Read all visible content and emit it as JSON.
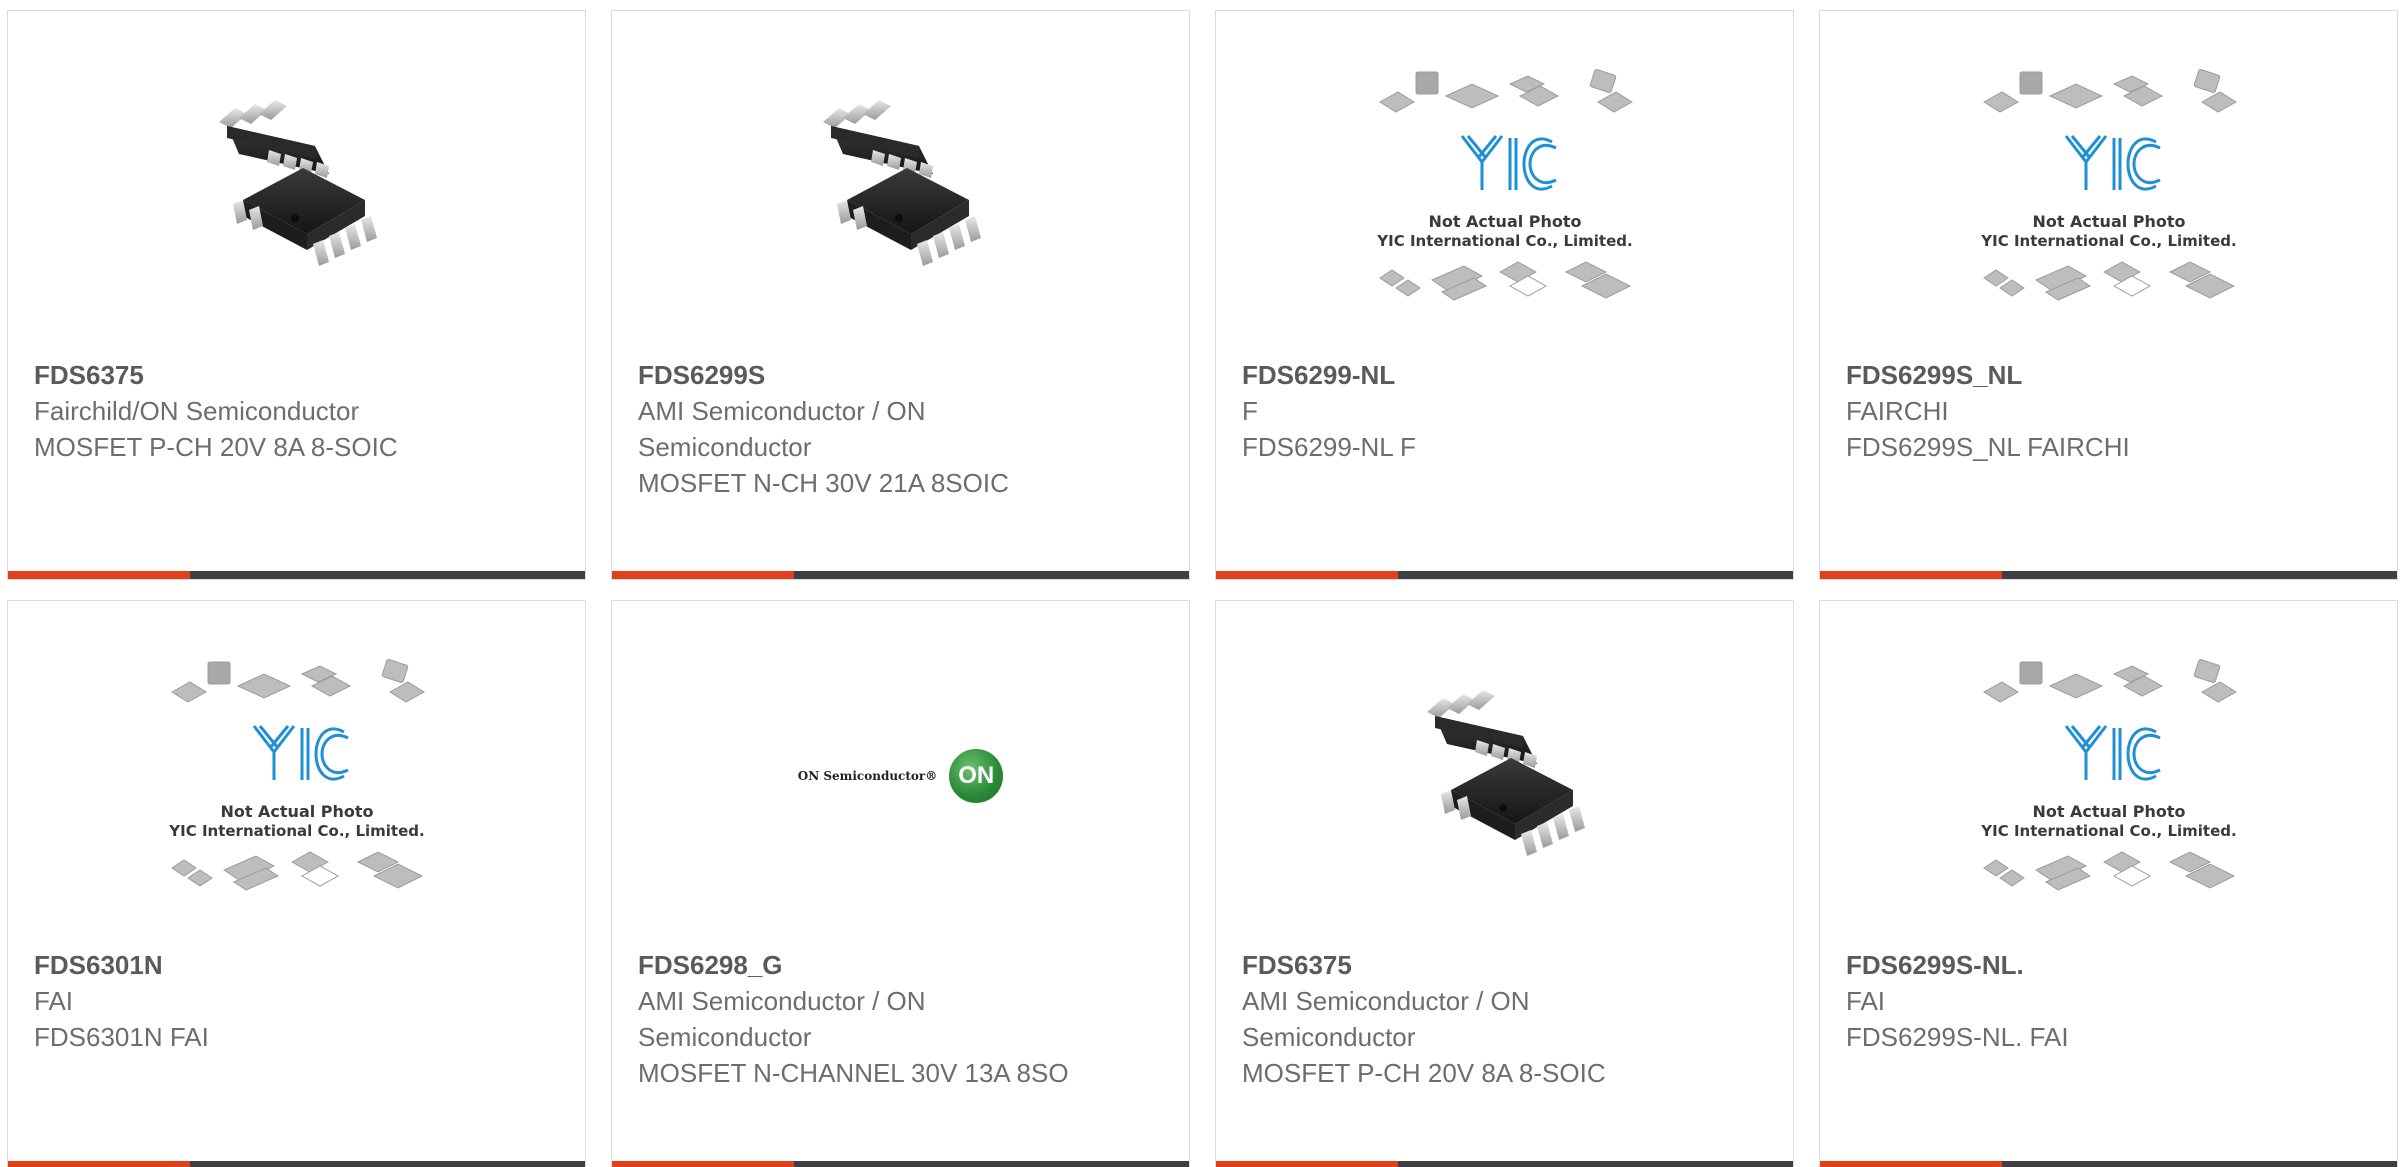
{
  "products": [
    {
      "part_number": "FDS6375",
      "manufacturer": "Fairchild/ON Semiconductor",
      "description": "MOSFET P-CH 20V 8A 8-SOIC",
      "image": "chip-photo"
    },
    {
      "part_number": "FDS6299S",
      "manufacturer": "AMI Semiconductor / ON Semiconductor",
      "description": "MOSFET N-CH 30V 21A 8SOIC",
      "image": "chip-photo"
    },
    {
      "part_number": "FDS6299-NL",
      "manufacturer": "F",
      "description": "FDS6299-NL F",
      "image": "yic-placeholder"
    },
    {
      "part_number": "FDS6299S_NL",
      "manufacturer": "FAIRCHI",
      "description": "FDS6299S_NL FAIRCHI",
      "image": "yic-placeholder"
    },
    {
      "part_number": "FDS6301N",
      "manufacturer": "FAI",
      "description": "FDS6301N FAI",
      "image": "yic-placeholder"
    },
    {
      "part_number": "FDS6298_G",
      "manufacturer": "AMI Semiconductor / ON Semiconductor",
      "description": "MOSFET N-CHANNEL 30V 13A 8SO",
      "image": "onsemi-logo"
    },
    {
      "part_number": "FDS6375",
      "manufacturer": "AMI Semiconductor / ON Semiconductor",
      "description": "MOSFET P-CH 20V 8A 8-SOIC",
      "image": "chip-photo"
    },
    {
      "part_number": "FDS6299S-NL.",
      "manufacturer": "FAI",
      "description": "FDS6299S-NL. FAI",
      "image": "yic-placeholder"
    }
  ],
  "placeholder_image": {
    "line1": "Not Actual Photo",
    "line2": "YIC International Co., Limited.",
    "logo_text": "YIC"
  },
  "onsemi_logo": {
    "wordmark": "ON Semiconductor®",
    "badge": "ON"
  },
  "colors": {
    "accent": "#e0401b",
    "bar": "#3d3f42",
    "part_number_text": "#5a5a5a",
    "body_text": "#6d6d6d",
    "yic_blue": "#1f8fd6"
  }
}
